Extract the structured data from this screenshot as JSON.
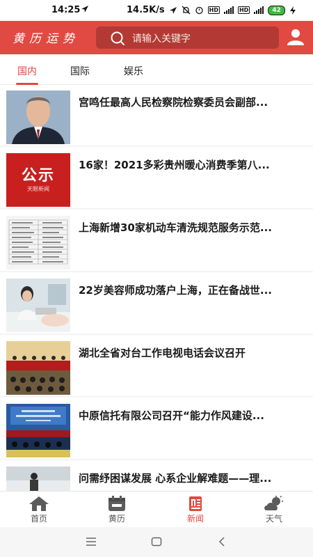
{
  "status": {
    "time": "14:25",
    "speed": "14.5K/s",
    "battery": "42"
  },
  "header": {
    "logo": "黄历运势",
    "search_placeholder": "请输入关键字"
  },
  "tabs": [
    {
      "label": "国内",
      "active": true
    },
    {
      "label": "国际",
      "active": false
    },
    {
      "label": "娱乐",
      "active": false
    }
  ],
  "news": [
    {
      "title": "宫鸣任最高人民检察院检察委员会副部..."
    },
    {
      "title": "16家！2021多彩贵州暖心消费季第八...",
      "thumb_text": "公示",
      "thumb_sub": "天眼新闻"
    },
    {
      "title": "上海新增30家机动车清洗规范服务示范..."
    },
    {
      "title": "22岁美容师成功落户上海，正在备战世..."
    },
    {
      "title": "湖北全省对台工作电视电话会议召开"
    },
    {
      "title": "中原信托有限公司召开“能力作风建设..."
    },
    {
      "title": "问需纾困谋发展 心系企业解难题——理..."
    }
  ],
  "tabbar": [
    {
      "label": "首页",
      "icon": "home-icon",
      "active": false
    },
    {
      "label": "黄历",
      "icon": "calendar-icon",
      "active": false
    },
    {
      "label": "新闻",
      "icon": "news-icon",
      "active": true
    },
    {
      "label": "天气",
      "icon": "weather-icon",
      "active": false
    }
  ],
  "colors": {
    "brand": "#e04a42",
    "search_bg": "#b33a34"
  }
}
